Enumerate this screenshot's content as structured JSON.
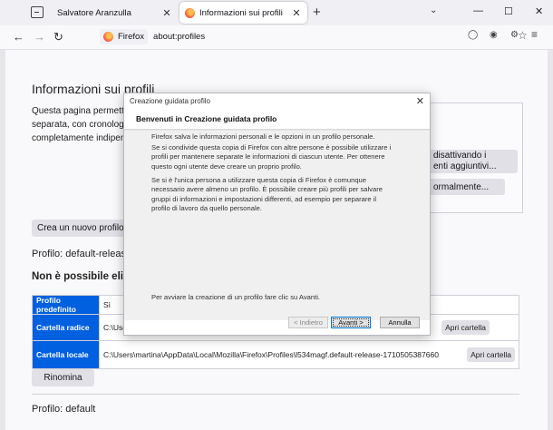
{
  "tabstrip": {
    "tabs": [
      {
        "title": "Salvatore Aranzulla",
        "active": false
      },
      {
        "title": "Informazioni sui profili",
        "active": true
      }
    ],
    "new_tab": "+",
    "close_glyph": "✕",
    "window_controls": {
      "minimize": "—",
      "maximize": "☐",
      "close": "✕"
    }
  },
  "navbar": {
    "back": "←",
    "forward": "→",
    "reload": "↻",
    "identity_label": "Firefox",
    "url": "about:profiles",
    "bookmark_star": "☆",
    "menu": "≡"
  },
  "page": {
    "title": "Informazioni sui profili",
    "intro_lines": [
      "Questa pagina permette",
      "separata, con cronologia",
      "completamente indipend"
    ],
    "side_buttons": {
      "rename_label": "disattivando i",
      "rename_label2": "enti aggiuntivi...",
      "restart_label": "ormalmente..."
    },
    "create_button": "Crea un nuovo profilo",
    "profile1_heading": "Profilo: default-release",
    "cant_remove_heading": "Non è possibile eliminare",
    "table": {
      "rows": [
        {
          "label": "Profilo predefinito",
          "value": "Sì"
        },
        {
          "label": "Cartella radice",
          "value": "C:\\Users",
          "button": "Apri cartella"
        },
        {
          "label": "Cartella locale",
          "value": "C:\\Users\\martina\\AppData\\Local\\Mozilla\\Firefox\\Profiles\\l534magf.default-release-1710505387660",
          "button": "Apri cartella"
        }
      ]
    },
    "rename_button": "Rinomina",
    "profile2_heading": "Profilo: default"
  },
  "dialog": {
    "title": "Creazione guidata profilo",
    "close": "✕",
    "header": "Benvenuti in Creazione guidata profilo",
    "paragraphs": [
      "Firefox salva le informazioni personali e le opzioni in un profilo personale.",
      "Se si condivide questa copia di Firefox con altre persone è possibile utilizzare i profili per mantenere separate le informazioni di ciascun utente. Per ottenere questo ogni utente deve creare un proprio profilo.",
      "Se si è l'unica persona a utilizzare questa copia di Firefox è comunque necessario avere almeno un profilo. È possibile creare più profili per salvare gruppi di informazioni e impostazioni differenti, ad esempio per separare il profilo di lavoro da quello personale."
    ],
    "footer_text": "Per avviare la creazione di un profilo fare clic su Avanti.",
    "buttons": {
      "back": "< Indietro",
      "next": "Avanti >",
      "cancel": "Annulla"
    }
  }
}
